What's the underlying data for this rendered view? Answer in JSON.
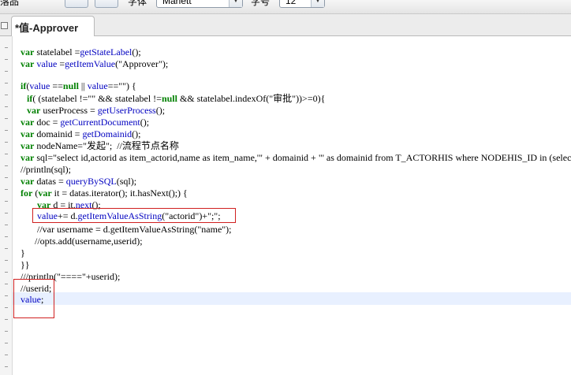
{
  "toolbar": {
    "left_label": "落品",
    "font_label": "字体",
    "font_value": "Marlett",
    "size_label": "字号",
    "size_value": "12"
  },
  "tab": {
    "title": "*值-Approver"
  },
  "code": {
    "line1": "var statelabel =getStateLabel();",
    "line2": "var value =getItemValue(\"Approver\");",
    "line3": "if(value ==null || value==\"\") {",
    "line4": "if( (statelabel !=\"\" && statelabel !=null && statelabel.indexOf(\"审批\"))>=0){",
    "line5": "var userProcess = getUserProcess();",
    "line6": "var doc = getCurrentDocument();",
    "line7": "var domainid = getDomainid();",
    "line8": "var nodeName=\"发起\";  //流程节点名称",
    "line9": "var sql=\"select id,actorid as item_actorid,name as item_name,'\" + domainid + \"' as domainid from T_ACTORHIS where NODEHIS_ID in (select",
    "line10": "//println(sql);",
    "line11": "var datas = queryBySQL(sql);",
    "line12": "for (var it = datas.iterator(); it.hasNext();) {",
    "line13": "var d = it.next();",
    "line14": "value+= d.getItemValueAsString(\"actorid\")+\";\";",
    "line15": "//var username = d.getItemValueAsString(\"name\");",
    "line16": "//opts.add(username,userid);",
    "line17": "}",
    "line18": "}}",
    "line19": "///println(\"====\"+userid);",
    "line20": "//userid;",
    "line21": "value;"
  },
  "colors": {
    "keyword": "#008000",
    "function": "#0000c0",
    "annotation": "#d02020",
    "highlight": "#e8f0ff"
  }
}
